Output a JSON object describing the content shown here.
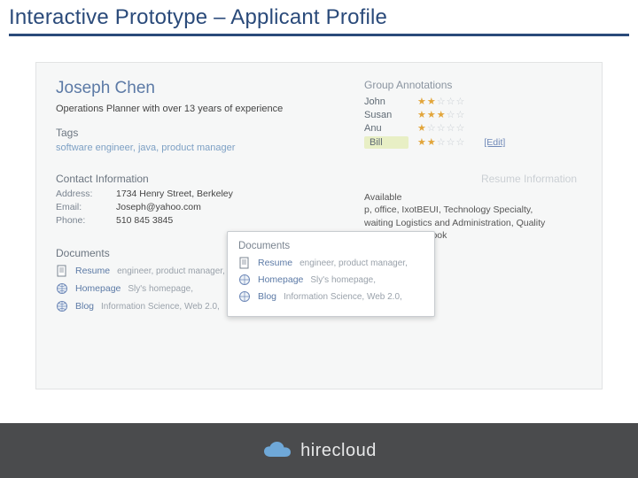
{
  "slide": {
    "title": "Interactive Prototype – Applicant Profile"
  },
  "applicant": {
    "name": "Joseph Chen",
    "headline": "Operations Planner with over 13 years of experience"
  },
  "tags": {
    "heading": "Tags",
    "value": "software engineer, java, product manager"
  },
  "contact": {
    "heading": "Contact Information",
    "address_label": "Address:",
    "address": "1734 Henry Street, Berkeley",
    "email_label": "Email:",
    "email": "Joseph@yahoo.com",
    "phone_label": "Phone:",
    "phone": "510 845 3845"
  },
  "group_annotations": {
    "heading": "Group Annotations",
    "edit_label": "[Edit]",
    "rows": [
      {
        "name": "John",
        "rating": 2
      },
      {
        "name": "Susan",
        "rating": 3
      },
      {
        "name": "Anu",
        "rating": 1
      },
      {
        "name": "Bill",
        "rating": 2,
        "highlight": true,
        "editable": true
      }
    ]
  },
  "documents": {
    "heading": "Documents",
    "items": [
      {
        "kind": "resume",
        "label": "Resume",
        "tags": "engineer, product manager,"
      },
      {
        "kind": "homepage",
        "label": "Homepage",
        "tags": "Sly's homepage,"
      },
      {
        "kind": "blog",
        "label": "Blog",
        "tags": "Information Science, Web 2.0,"
      }
    ]
  },
  "resume_info": {
    "heading": "Resume Information",
    "lines": [
      "Available",
      "p, office, IxotBEUI, Technology Specialty,",
      "waiting Logistics and Administration, Quality",
      "p, Microsoft Outlook"
    ]
  },
  "footer": {
    "brand": "hirecloud"
  }
}
